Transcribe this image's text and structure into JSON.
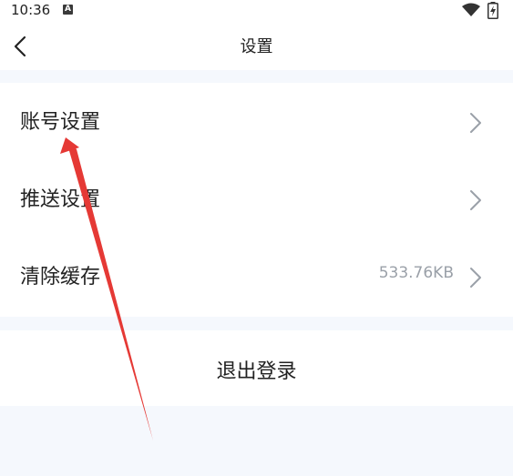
{
  "status": {
    "time": "10:36",
    "notification_icon": "a-icon",
    "wifi_icon": "wifi-icon",
    "battery_icon": "battery-icon"
  },
  "header": {
    "title": "设置",
    "back_icon": "chevron-left-icon"
  },
  "settings": {
    "items": [
      {
        "label": "账号设置",
        "value": ""
      },
      {
        "label": "推送设置",
        "value": ""
      },
      {
        "label": "清除缓存",
        "value": "533.76KB"
      }
    ],
    "logout_label": "退出登录"
  },
  "colors": {
    "background": "#f5f8fd",
    "annotation_arrow": "#e53935",
    "muted_text": "#9aa0a8"
  }
}
